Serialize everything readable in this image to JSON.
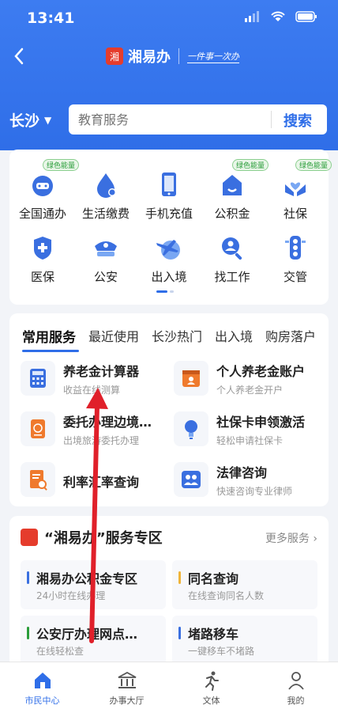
{
  "status": {
    "time": "13:41"
  },
  "nav": {
    "app_name": "湘易办",
    "slogan": "一件事一次办"
  },
  "search": {
    "city": "长沙",
    "placeholder": "教育服务",
    "button": "搜索"
  },
  "grid": {
    "items": [
      {
        "label": "全国通办",
        "badge": "绿色能量",
        "icon": "globe-service-icon"
      },
      {
        "label": "生活缴费",
        "badge": "",
        "icon": "water-drop-icon"
      },
      {
        "label": "手机充值",
        "badge": "",
        "icon": "phone-icon"
      },
      {
        "label": "公积金",
        "badge": "绿色能量",
        "icon": "housing-fund-icon"
      },
      {
        "label": "社保",
        "badge": "绿色能量",
        "icon": "heart-hands-icon"
      },
      {
        "label": "医保",
        "badge": "",
        "icon": "medical-insurance-icon"
      },
      {
        "label": "公安",
        "badge": "",
        "icon": "police-cap-icon"
      },
      {
        "label": "出入境",
        "badge": "",
        "icon": "airplane-globe-icon"
      },
      {
        "label": "找工作",
        "badge": "",
        "icon": "job-search-icon"
      },
      {
        "label": "交管",
        "badge": "",
        "icon": "traffic-light-icon"
      }
    ]
  },
  "services": {
    "tabs": [
      "常用服务",
      "最近使用",
      "长沙热门",
      "出入境",
      "购房落户"
    ],
    "items": [
      {
        "title": "养老金计算器",
        "subtitle": "收益在线测算",
        "icon": "calculator-icon",
        "color": "#3a6fe0"
      },
      {
        "title": "个人养老金账户",
        "subtitle": "个人养老金开户",
        "icon": "calendar-account-icon",
        "color": "#ef7a2d"
      },
      {
        "title": "委托办理边境…",
        "subtitle": "出境旅游委托办理",
        "icon": "passport-icon",
        "color": "#ef7a2d"
      },
      {
        "title": "社保卡申领激活",
        "subtitle": "轻松申请社保卡",
        "icon": "bulb-icon",
        "color": "#3a6fe0"
      },
      {
        "title": "利率汇率查询",
        "subtitle": "",
        "icon": "document-search-icon",
        "color": "#ef7a2d"
      },
      {
        "title": "法律咨询",
        "subtitle": "快速咨询专业律师",
        "icon": "people-icon",
        "color": "#3a6fe0"
      }
    ]
  },
  "zone": {
    "title": "“湘易办”服务专区",
    "more": "更多服务",
    "items": [
      {
        "title": "湘易办公积金专区",
        "subtitle": "24小时在线办理",
        "accent": "#3a6fe0"
      },
      {
        "title": "同名查询",
        "subtitle": "在线查询同名人数",
        "accent": "#f0b43a"
      },
      {
        "title": "公安厅办理网点…",
        "subtitle": "在线轻松查",
        "accent": "#2a9d3a"
      },
      {
        "title": "堵路移车",
        "subtitle": "一键移车不堵路",
        "accent": "#3a6fe0"
      }
    ]
  },
  "tabbar": {
    "items": [
      {
        "label": "市民中心",
        "icon": "home-icon",
        "active": true
      },
      {
        "label": "办事大厅",
        "icon": "hall-icon",
        "active": false
      },
      {
        "label": "文体",
        "icon": "runner-icon",
        "active": false
      },
      {
        "label": "我的",
        "icon": "user-icon",
        "active": false
      }
    ]
  },
  "colors": {
    "primary": "#2f6ee8",
    "annotation_arrow": "#e0202a"
  }
}
